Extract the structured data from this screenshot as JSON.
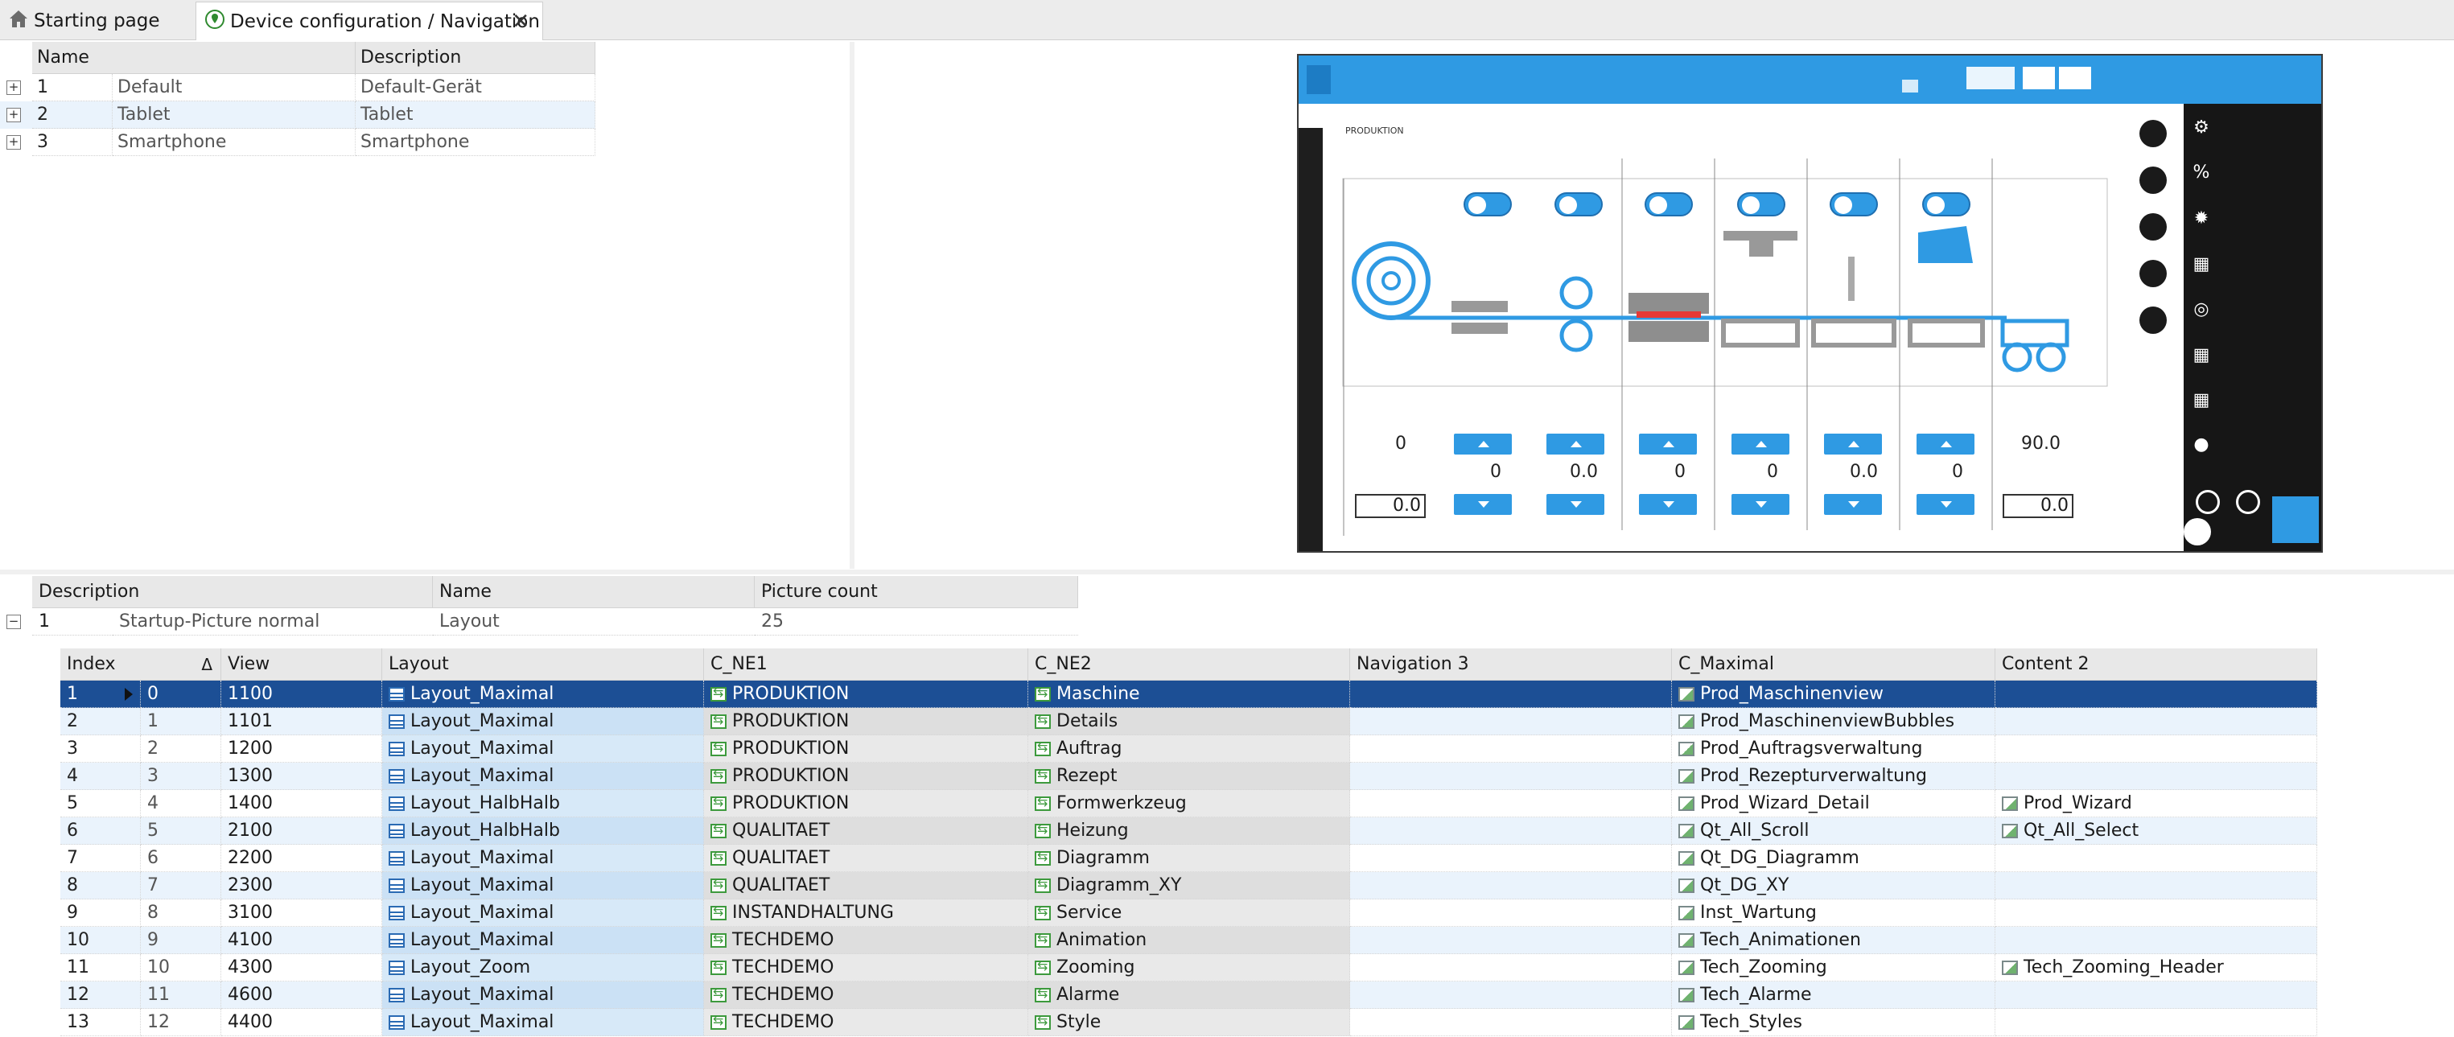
{
  "tabs": [
    {
      "label": "Starting page",
      "icon": "home-icon"
    },
    {
      "label": "Device configuration / Navigation",
      "icon": "location-pin-icon",
      "close": "✕"
    }
  ],
  "devices": {
    "columns": [
      "Name",
      "Description"
    ],
    "rows": [
      {
        "index": "1",
        "name": "Default",
        "description": "Default-Gerät"
      },
      {
        "index": "2",
        "name": "Tablet",
        "description": "Tablet"
      },
      {
        "index": "3",
        "name": "Smartphone",
        "description": "Smartphone"
      }
    ]
  },
  "preview": {
    "heading": "PRODUKTION",
    "readouts": [
      "0",
      "0",
      "0.0",
      "0",
      "0",
      "0.0",
      "0",
      "90.0"
    ],
    "fields": [
      "0.0",
      "0.0"
    ]
  },
  "startup": {
    "columns": [
      "Description",
      "Name",
      "Picture count"
    ],
    "row": {
      "index": "1",
      "description": "Startup-Picture normal",
      "name": "Layout",
      "picture_count": "25"
    }
  },
  "pictures": {
    "columns": [
      "Index",
      "View",
      "Layout",
      "C_NE1",
      "C_NE2",
      "Navigation 3",
      "C_Maximal",
      "Content 2"
    ],
    "sort_icon": "Δ",
    "rows": [
      {
        "index": "1",
        "sub": "0",
        "view": "1100",
        "layout": "Layout_Maximal",
        "ne1": "PRODUKTION",
        "ne2": "Maschine",
        "nav3": "",
        "max": "Prod_Maschinenview",
        "content2": ""
      },
      {
        "index": "2",
        "sub": "1",
        "view": "1101",
        "layout": "Layout_Maximal",
        "ne1": "PRODUKTION",
        "ne2": "Details",
        "nav3": "",
        "max": "Prod_MaschinenviewBubbles",
        "content2": ""
      },
      {
        "index": "3",
        "sub": "2",
        "view": "1200",
        "layout": "Layout_Maximal",
        "ne1": "PRODUKTION",
        "ne2": "Auftrag",
        "nav3": "",
        "max": "Prod_Auftragsverwaltung",
        "content2": ""
      },
      {
        "index": "4",
        "sub": "3",
        "view": "1300",
        "layout": "Layout_Maximal",
        "ne1": "PRODUKTION",
        "ne2": "Rezept",
        "nav3": "",
        "max": "Prod_Rezepturverwaltung",
        "content2": ""
      },
      {
        "index": "5",
        "sub": "4",
        "view": "1400",
        "layout": "Layout_HalbHalb",
        "ne1": "PRODUKTION",
        "ne2": "Formwerkzeug",
        "nav3": "",
        "max": "Prod_Wizard_Detail",
        "content2": "Prod_Wizard"
      },
      {
        "index": "6",
        "sub": "5",
        "view": "2100",
        "layout": "Layout_HalbHalb",
        "ne1": "QUALITAET",
        "ne2": "Heizung",
        "nav3": "",
        "max": "Qt_All_Scroll",
        "content2": "Qt_All_Select"
      },
      {
        "index": "7",
        "sub": "6",
        "view": "2200",
        "layout": "Layout_Maximal",
        "ne1": "QUALITAET",
        "ne2": "Diagramm",
        "nav3": "",
        "max": "Qt_DG_Diagramm",
        "content2": ""
      },
      {
        "index": "8",
        "sub": "7",
        "view": "2300",
        "layout": "Layout_Maximal",
        "ne1": "QUALITAET",
        "ne2": "Diagramm_XY",
        "nav3": "",
        "max": "Qt_DG_XY",
        "content2": ""
      },
      {
        "index": "9",
        "sub": "8",
        "view": "3100",
        "layout": "Layout_Maximal",
        "ne1": "INSTANDHALTUNG",
        "ne2": "Service",
        "nav3": "",
        "max": "Inst_Wartung",
        "content2": ""
      },
      {
        "index": "10",
        "sub": "9",
        "view": "4100",
        "layout": "Layout_Maximal",
        "ne1": "TECHDEMO",
        "ne2": "Animation",
        "nav3": "",
        "max": "Tech_Animationen",
        "content2": ""
      },
      {
        "index": "11",
        "sub": "10",
        "view": "4300",
        "layout": "Layout_Zoom",
        "ne1": "TECHDEMO",
        "ne2": "Zooming",
        "nav3": "",
        "max": "Tech_Zooming",
        "content2": "Tech_Zooming_Header"
      },
      {
        "index": "12",
        "sub": "11",
        "view": "4600",
        "layout": "Layout_Maximal",
        "ne1": "TECHDEMO",
        "ne2": "Alarme",
        "nav3": "",
        "max": "Tech_Alarme",
        "content2": ""
      },
      {
        "index": "13",
        "sub": "12",
        "view": "4400",
        "layout": "Layout_Maximal",
        "ne1": "TECHDEMO",
        "ne2": "Style",
        "nav3": "",
        "max": "Tech_Styles",
        "content2": ""
      }
    ]
  }
}
